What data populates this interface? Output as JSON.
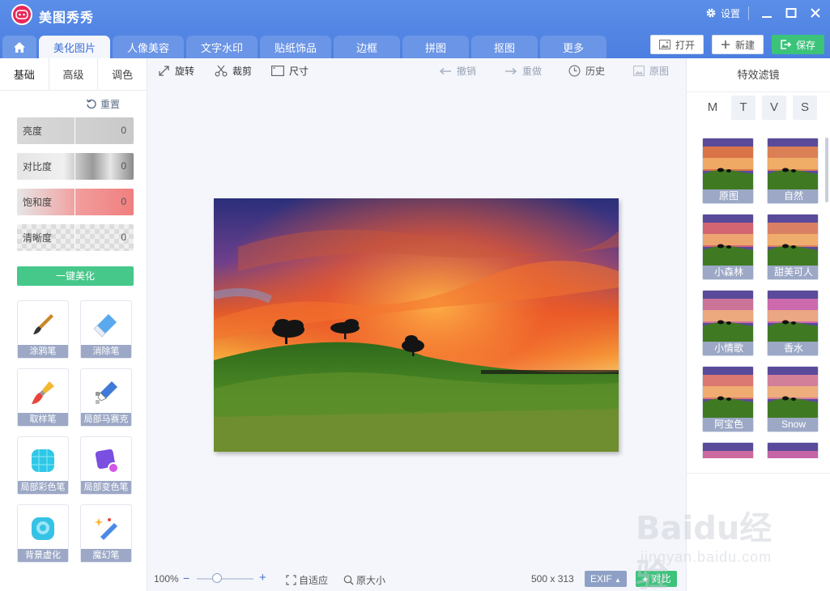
{
  "app": {
    "title": "美图秀秀",
    "logo_text": "meitu"
  },
  "window": {
    "settings_label": "设置"
  },
  "tabs": [
    "美化图片",
    "人像美容",
    "文字水印",
    "贴纸饰品",
    "边框",
    "拼图",
    "抠图",
    "更多"
  ],
  "actions": {
    "open": "打开",
    "new": "新建",
    "save": "保存"
  },
  "left": {
    "subtabs": [
      "基础",
      "高级",
      "调色"
    ],
    "reset": "重置",
    "sliders": [
      {
        "label": "亮度",
        "value": "0"
      },
      {
        "label": "对比度",
        "value": "0"
      },
      {
        "label": "饱和度",
        "value": "0"
      },
      {
        "label": "清晰度",
        "value": "0"
      }
    ],
    "auto_beautify": "一键美化",
    "tools": [
      "涂鸦笔",
      "消除笔",
      "取样笔",
      "局部马赛克",
      "局部彩色笔",
      "局部变色笔",
      "背景虚化",
      "魔幻笔"
    ]
  },
  "toolbar": {
    "rotate": "旋转",
    "crop": "裁剪",
    "size": "尺寸",
    "undo": "撤销",
    "redo": "重做",
    "history": "历史",
    "original": "原图"
  },
  "status": {
    "zoom": "100%",
    "zoom_level": 0.35,
    "fit": "自适应",
    "actual_size": "原大小",
    "dimensions": "500 x 313",
    "exif": "EXIF",
    "compare": "对比"
  },
  "right": {
    "title": "特效滤镜",
    "letters": [
      "M",
      "T",
      "V",
      "S"
    ],
    "filters": [
      "原图",
      "自然",
      "小森林",
      "甜美可人",
      "小情歌",
      "香水",
      "阿宝色",
      "Snow"
    ]
  },
  "watermark": {
    "brand": "Baidu经验",
    "url": "jingyan.baidu.com"
  }
}
